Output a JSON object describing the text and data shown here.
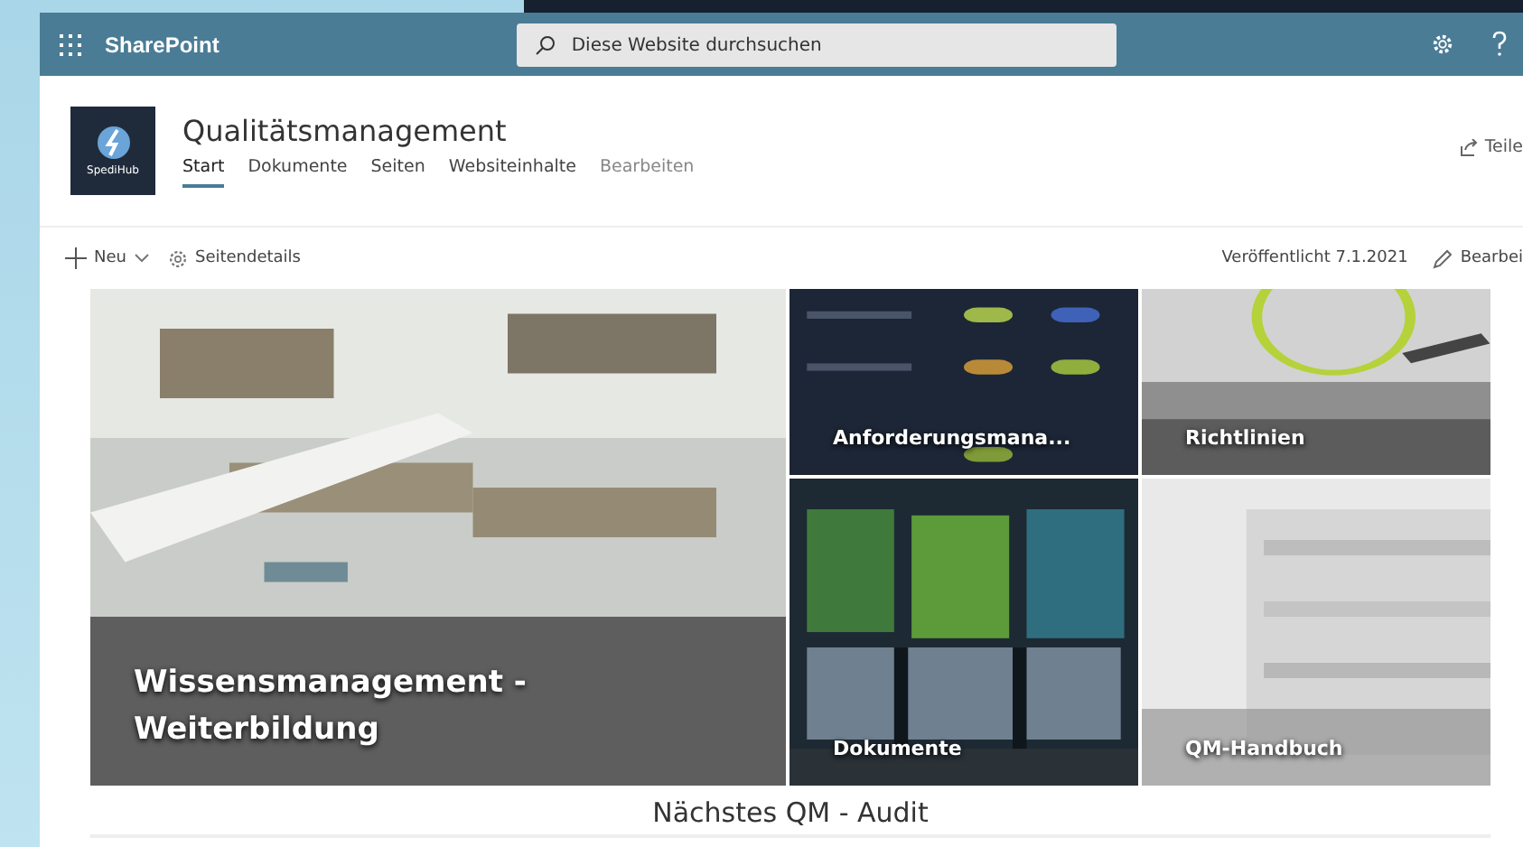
{
  "suite_bar": {
    "app_name": "SharePoint",
    "search": {
      "placeholder": "Diese Website durchsuchen"
    }
  },
  "site_header": {
    "title": "Qualitätsmanagement",
    "logo_text": "SpediHub",
    "nav": [
      {
        "label": "Start",
        "selected": true
      },
      {
        "label": "Dokumente",
        "selected": false
      },
      {
        "label": "Seiten",
        "selected": false
      },
      {
        "label": "Websiteinhalte",
        "selected": false
      }
    ],
    "edit_link": "Bearbeiten",
    "share": "Teile"
  },
  "command_bar": {
    "new": "Neu",
    "page_details": "Seitendetails",
    "published": "Veröffentlicht 7.1.2021",
    "edit": "Bearbei"
  },
  "hero_tiles": [
    {
      "title": "Wissensmanagement - Weiterbildung"
    },
    {
      "title": "Anforderungsmana..."
    },
    {
      "title": "Richtlinien"
    },
    {
      "title": "Dokumente"
    },
    {
      "title": "QM-Handbuch"
    }
  ],
  "section_title": "Nächstes QM - Audit"
}
